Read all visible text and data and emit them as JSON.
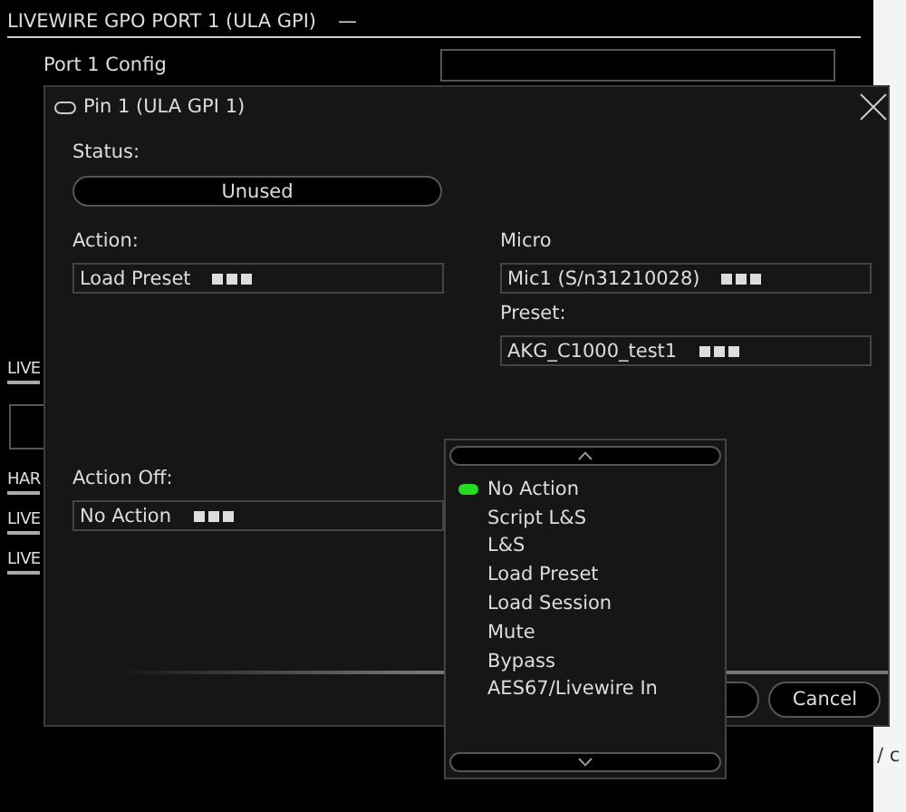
{
  "page": {
    "section_title": "LIVEWIRE GPO PORT 1 (ULA GPI)",
    "collapse_symbol": "—",
    "config_label": "Port 1 Config",
    "side_sections": [
      {
        "label": "LIVE",
        "kind": "section"
      },
      {
        "kind": "toggle"
      },
      {
        "label": "HAR",
        "kind": "section"
      },
      {
        "label": "LIVE",
        "kind": "section"
      },
      {
        "label": "LIVE",
        "kind": "section"
      }
    ],
    "corner_text": "/ c"
  },
  "dialog": {
    "title": "Pin 1 (ULA GPI 1)",
    "status_label": "Status:",
    "status": "Unused",
    "action_label": "Action:",
    "action": "Load Preset",
    "micro_label": "Micro",
    "micro": "Mic1 (S/n31210028)",
    "preset_label": "Preset:",
    "preset": "AKG_C1000_test1",
    "action_off_label": "Action Off:",
    "action_off": "No Action",
    "cancel": "Cancel"
  },
  "dropdown": {
    "items": [
      {
        "label": "No Action",
        "selected": true
      },
      {
        "label": "Script L&S",
        "selected": false
      },
      {
        "label": "L&S",
        "selected": false
      },
      {
        "label": "Load Preset",
        "selected": false
      },
      {
        "label": "Load Session",
        "selected": false
      },
      {
        "label": "Mute",
        "selected": false
      },
      {
        "label": "Bypass",
        "selected": false
      },
      {
        "label": "AES67/Livewire In",
        "selected": false
      }
    ]
  }
}
